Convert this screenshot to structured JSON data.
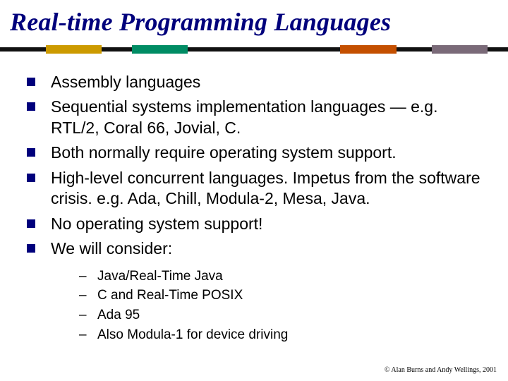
{
  "title": "Real-time Programming Languages",
  "bullets": [
    "Assembly languages",
    "Sequential systems implementation languages — e.g. RTL/2, Coral 66, Jovial, C.",
    "Both normally require operating system support.",
    "High-level concurrent languages. Impetus from the software crisis. e.g. Ada, Chill, Modula-2, Mesa, Java.",
    "No operating system support!",
    "We will consider:"
  ],
  "subbullets": [
    "Java/Real-Time Java",
    "C and Real-Time POSIX",
    "Ada 95",
    "Also Modula-1 for device driving"
  ],
  "footer": "© Alan Burns and Andy Wellings, 2001"
}
